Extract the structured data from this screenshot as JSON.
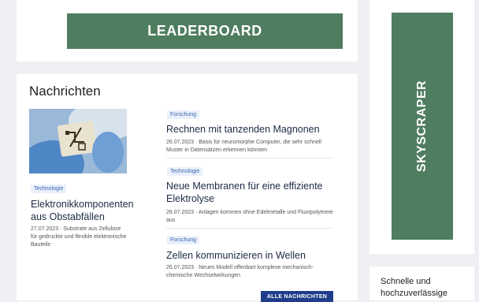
{
  "ads": {
    "leaderboard_label": "LEADERBOARD",
    "skyscraper_label": "SKYSCRAPER",
    "color": "#4f7d5f"
  },
  "news": {
    "heading": "Nachrichten",
    "featured": {
      "tag": "Technologie",
      "title": "Elektronikkomponenten aus Obstabfällen",
      "meta": "27.07.2023 · Substrate aus Zellulose für gedruckte und flexible elektronische Bauteile"
    },
    "articles": [
      {
        "tag": "Forschung",
        "title": "Rechnen mit tanzenden Magnonen",
        "meta": "26.07.2023 · Basis für neuromorphe Computer, die sehr schnell Muster in Datensätzen erkennen könnten"
      },
      {
        "tag": "Technologie",
        "title": "Neue Membranen für eine effiziente Elektrolyse",
        "meta": "26.07.2023 · Anlagen kommen ohne Edelmetalle und Fluorpolymere aus"
      },
      {
        "tag": "Forschung",
        "title": "Zellen kommunizieren in Wellen",
        "meta": "26.07.2023 · Neues Modell offenbart komplexe mechanisch-chemische Wechselwirkungen"
      }
    ],
    "all_news_label": "ALLE NACHRICHTEN",
    "accent_color": "#1f3d8a"
  },
  "promo": {
    "text": "Schnelle und hochzuverlässige"
  },
  "icons": {
    "featured_image": "glove-holding-electronic-chip-image"
  }
}
